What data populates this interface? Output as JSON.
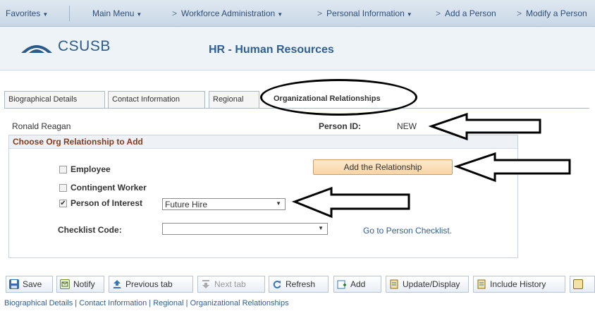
{
  "nav": {
    "favorites": "Favorites",
    "main_menu": "Main Menu",
    "crumbs": [
      "Workforce Administration",
      "Personal Information",
      "Add a Person",
      "Modify a Person"
    ]
  },
  "header": {
    "logo_text": "CSUSB",
    "title": "HR - Human Resources"
  },
  "tabs": [
    "Biographical Details",
    "Contact Information",
    "Regional",
    "Organizational Relationships"
  ],
  "person": {
    "name": "Ronald Reagan",
    "id_label": "Person ID:",
    "id_value": "NEW"
  },
  "org": {
    "header": "Choose Org Relationship to Add",
    "employee": {
      "label": "Employee",
      "checked": false
    },
    "contingent": {
      "label": "Contingent Worker",
      "checked": false
    },
    "poi": {
      "label": "Person of Interest",
      "checked": true
    },
    "poi_type_value": "Future Hire",
    "add_button": "Add the Relationship",
    "checklist_label": "Checklist Code:",
    "checklist_value": "",
    "checklist_link": "Go to Person Checklist."
  },
  "toolbar": {
    "save": "Save",
    "notify": "Notify",
    "previous_tab": "Previous tab",
    "next_tab": "Next tab",
    "refresh": "Refresh",
    "add": "Add",
    "update_display": "Update/Display",
    "include_history": "Include History"
  },
  "bottom_links": {
    "biographical": "Biographical Details",
    "contact": "Contact Information",
    "regional": "Regional",
    "org": "Organizational Relationships",
    "separator": " | "
  },
  "colors": {
    "accent": "#2f5f93",
    "group_header_text": "#8a3a1a",
    "button_orange": "#f9d4a3"
  },
  "icons": [
    "save-icon",
    "notify-icon",
    "previous-tab-icon",
    "next-tab-icon",
    "refresh-icon",
    "add-icon",
    "update-display-icon",
    "include-history-icon",
    "checkmark-icon",
    "dropdown-arrow-icon"
  ]
}
